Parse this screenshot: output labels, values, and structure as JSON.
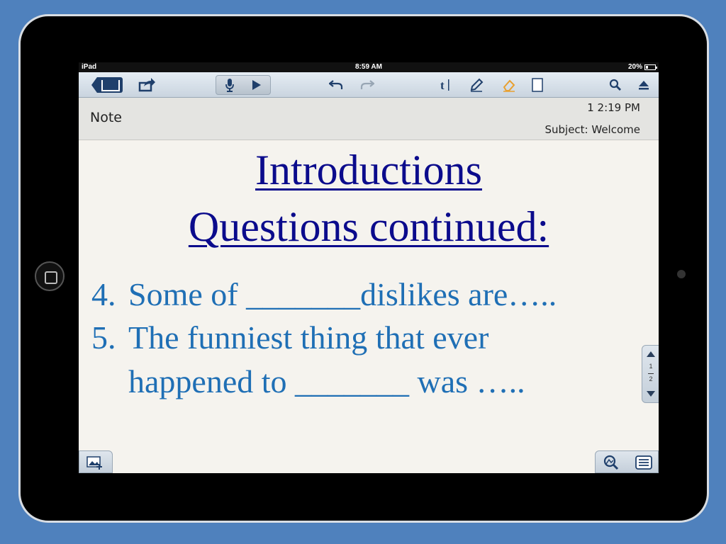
{
  "status_bar": {
    "device": "iPad",
    "time": "8:59 AM",
    "battery": "20%"
  },
  "toolbar": {
    "icons": [
      "library-icon",
      "share-icon",
      "microphone-icon",
      "play-icon",
      "undo-icon",
      "redo-icon",
      "text-tool-icon",
      "pen-icon",
      "eraser-icon",
      "page-icon",
      "search-icon",
      "eject-icon"
    ]
  },
  "note_header": {
    "label": "Note",
    "time": "1 2:19 PM",
    "subject": "Subject: Welcome"
  },
  "slide": {
    "title_line1": "Introductions",
    "title_line2": "Questions continued:",
    "items": [
      {
        "number": "4.",
        "text": "Some of _______dislikes are….."
      },
      {
        "number": "5.",
        "text": "The funniest thing that ever",
        "continuation": "happened to _______ was ….."
      }
    ]
  },
  "page_scroller": {
    "current": "1",
    "total": "2"
  },
  "colors": {
    "background": "#4f81bd",
    "title": "#0b0b8c",
    "body_text": "#1f6fb5",
    "toolbar_accent": "#1f3f6b",
    "eraser": "#e8a030"
  }
}
